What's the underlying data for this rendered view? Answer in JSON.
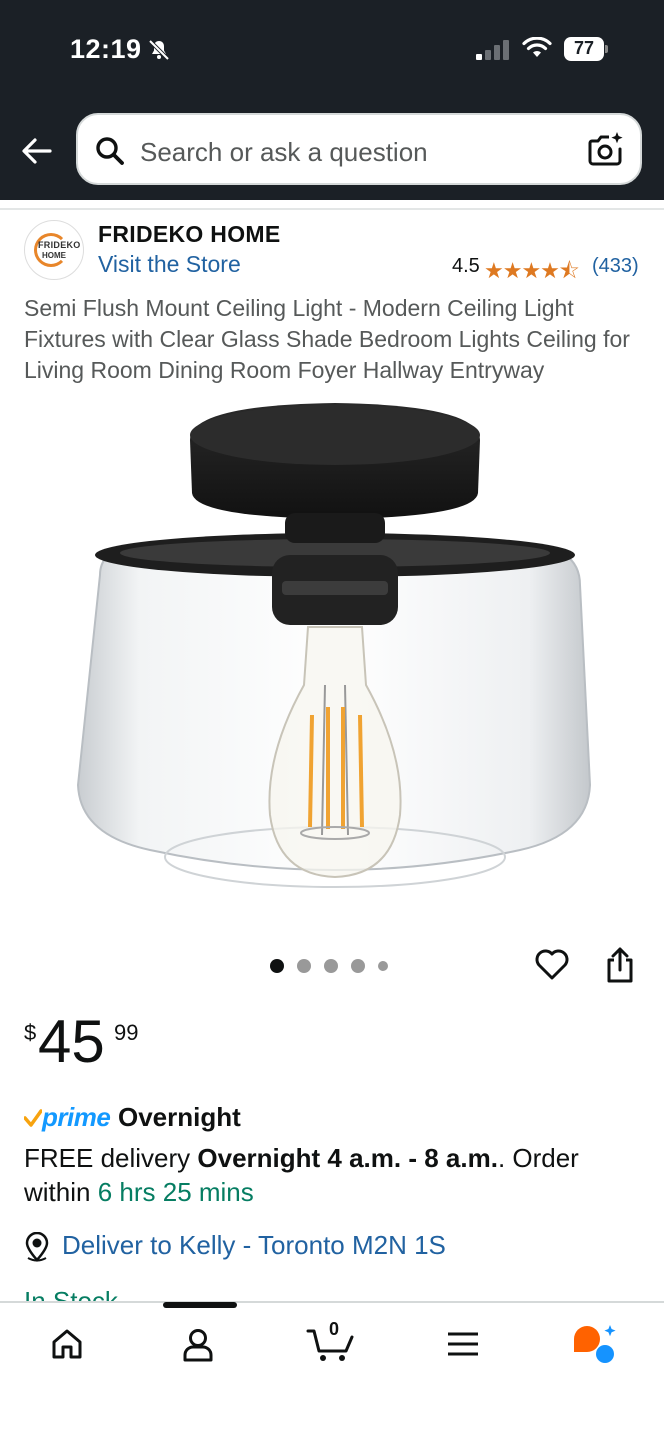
{
  "status_bar": {
    "time": "12:19",
    "battery": "77"
  },
  "search": {
    "placeholder": "Search or ask a question"
  },
  "store": {
    "logo_text_1": "FRIDEKO",
    "logo_text_2": "HOME",
    "name": "FRIDEKO HOME",
    "visit_label": "Visit the Store",
    "rating": "4.5",
    "stars": "★★★★⯪",
    "rating_count": "(433)"
  },
  "product": {
    "title": "Semi Flush Mount Ceiling Light - Modern Ceiling Light Fixtures with Clear Glass Shade Bedroom Lights Ceiling for Living Room Dining Room Foyer Hallway Entryway",
    "image_dots": 5,
    "active_dot": 1,
    "price_symbol": "$",
    "price_whole": "45",
    "price_fraction": "99"
  },
  "delivery": {
    "prime_word": "prime",
    "prime_speed": "Overnight",
    "line_prefix": "FREE delivery ",
    "line_bold": "Overnight 4 a.m. - 8 a.m.",
    "line_mid": ". Order within ",
    "countdown": "6 hrs 25 mins",
    "deliver_to": "Deliver to Kelly - Toronto M2N 1S",
    "stock": "In Stock"
  },
  "bottom_nav": {
    "cart_count": "0",
    "items": [
      "home-icon",
      "account-icon",
      "cart-icon",
      "menu-icon",
      "rufus-ai-icon"
    ]
  },
  "colors": {
    "header_bg": "#1b2026",
    "link_blue": "#2162a1",
    "star_orange": "#de7921",
    "prime_blue": "#1399ff",
    "in_stock_green": "#067d62"
  }
}
